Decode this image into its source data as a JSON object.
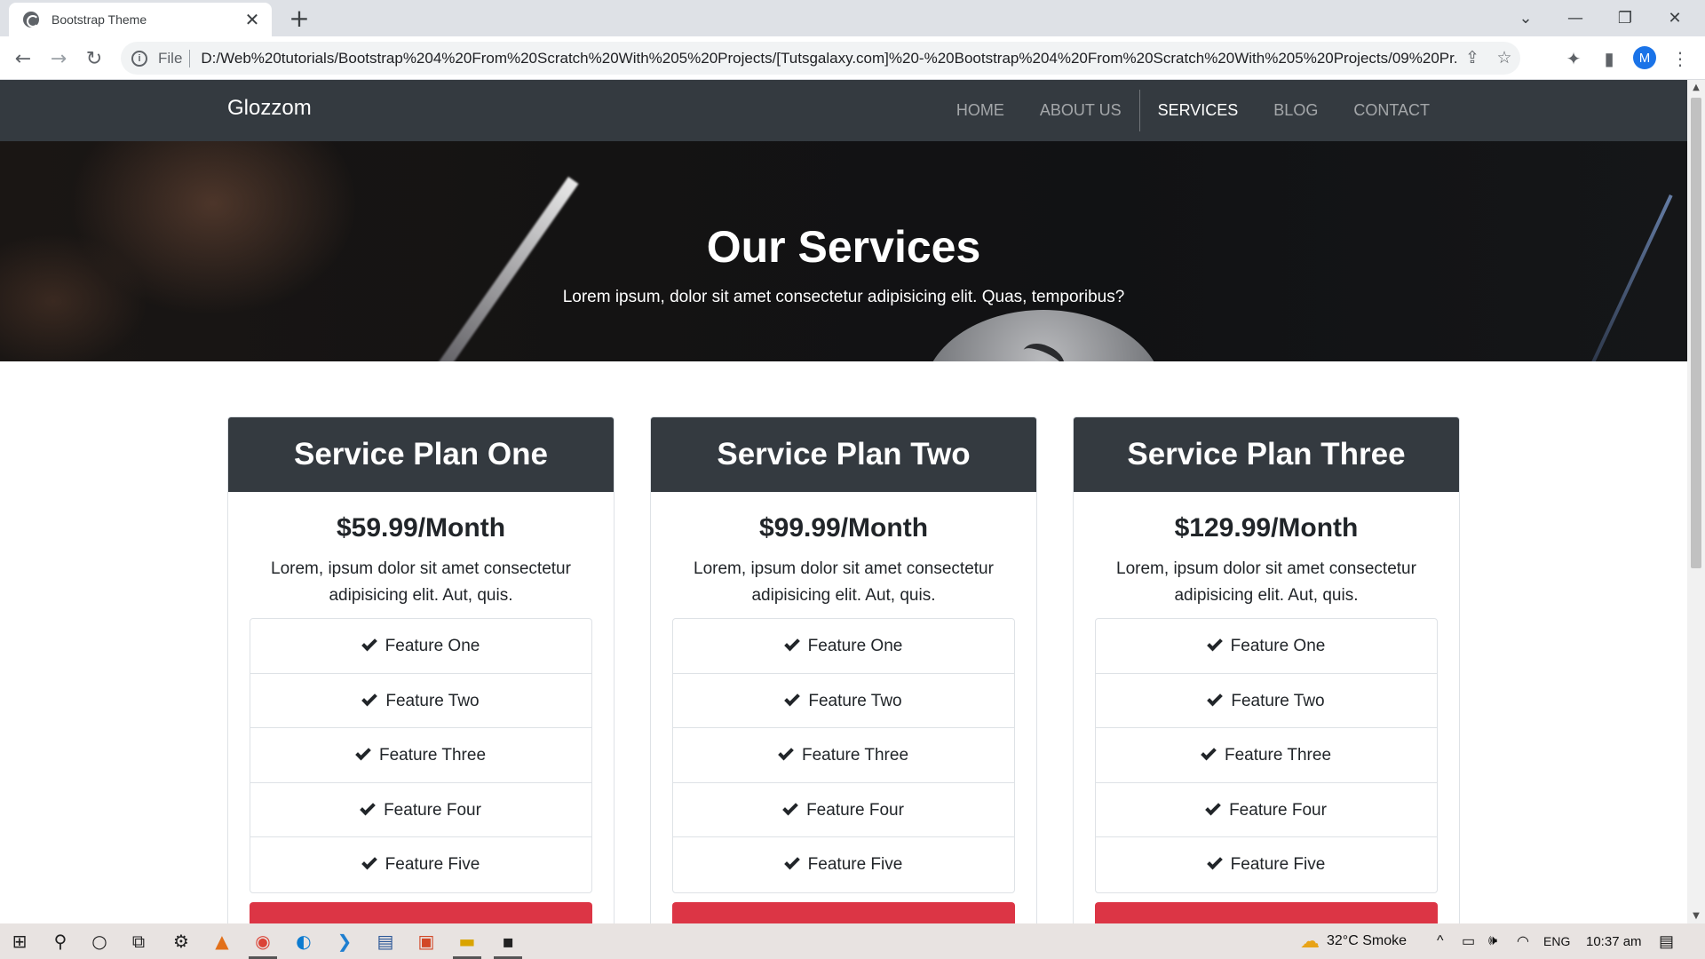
{
  "browser": {
    "tab_title": "Bootstrap Theme",
    "tab_close": "✕",
    "new_tab": "+",
    "scheme": "File",
    "url": "D:/Web%20tutorials/Bootstrap%204%20From%20Scratch%20With%205%20Projects/[Tutsgalaxy.com]%20-%20Bootstrap%204%20From%20Scratch%20With%205%20Projects/09%20Pr...",
    "profile_initial": "M"
  },
  "site": {
    "brand": "Glozzom",
    "nav": [
      {
        "label": "HOME",
        "active": false
      },
      {
        "label": "ABOUT US",
        "active": false
      },
      {
        "label": "SERVICES",
        "active": true
      },
      {
        "label": "BLOG",
        "active": false
      },
      {
        "label": "CONTACT",
        "active": false
      }
    ]
  },
  "hero": {
    "title": "Our Services",
    "subtitle": "Lorem ipsum, dolor sit amet consectetur adipisicing elit. Quas, temporibus?"
  },
  "plans": [
    {
      "name": "Service Plan One",
      "price": "$59.99/Month",
      "description": "Lorem, ipsum dolor sit amet consectetur adipisicing elit. Aut, quis.",
      "features": [
        "Feature One",
        "Feature Two",
        "Feature Three",
        "Feature Four",
        "Feature Five"
      ]
    },
    {
      "name": "Service Plan Two",
      "price": "$99.99/Month",
      "description": "Lorem, ipsum dolor sit amet consectetur adipisicing elit. Aut, quis.",
      "features": [
        "Feature One",
        "Feature Two",
        "Feature Three",
        "Feature Four",
        "Feature Five"
      ]
    },
    {
      "name": "Service Plan Three",
      "price": "$129.99/Month",
      "description": "Lorem, ipsum dolor sit amet consectetur adipisicing elit. Aut, quis.",
      "features": [
        "Feature One",
        "Feature Two",
        "Feature Three",
        "Feature Four",
        "Feature Five"
      ]
    }
  ],
  "taskbar": {
    "weather": "32°C  Smoke",
    "language": "ENG",
    "time": "10:37 am"
  },
  "colors": {
    "navbar": "#343a40",
    "button": "#dc3545"
  }
}
